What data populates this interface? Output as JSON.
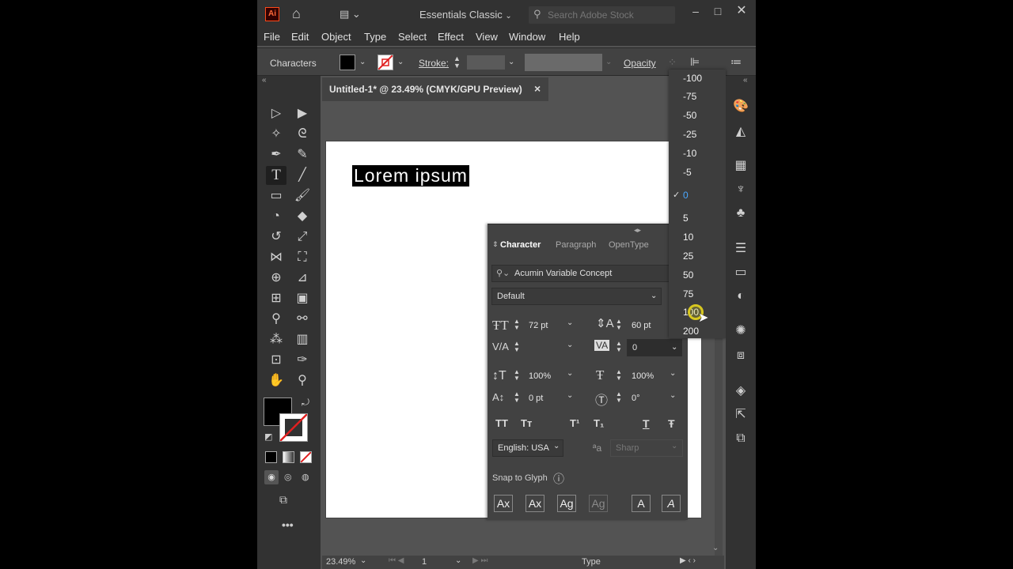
{
  "app": {
    "logo": "Ai",
    "workspace": "Essentials Classic",
    "search_placeholder": "Search Adobe Stock"
  },
  "menu": [
    "File",
    "Edit",
    "Object",
    "Type",
    "Select",
    "Effect",
    "View",
    "Window",
    "Help"
  ],
  "control": {
    "selection_label": "Characters",
    "stroke_label": "Stroke:",
    "opacity_label": "Opacity"
  },
  "document": {
    "tab_title": "Untitled-1* @ 23.49% (CMYK/GPU Preview)",
    "close": "×",
    "artboard_text": "Lorem ipsum"
  },
  "status": {
    "zoom": "23.49%",
    "artboard_num": "1",
    "tool": "Type"
  },
  "character_panel": {
    "tabs": [
      "Character",
      "Paragraph",
      "OpenType"
    ],
    "font_family": "Acumin Variable Concept",
    "font_style": "Default",
    "font_size": "72 pt",
    "leading": "60 pt",
    "kerning": "",
    "tracking": "0",
    "vertical_scale": "100%",
    "horizontal_scale": "100%",
    "baseline_shift": "0 pt",
    "rotation": "0°",
    "language": "English: USA",
    "antialiasing": "Sharp",
    "snap_label": "Snap to Glyph",
    "style_buttons": [
      "TT",
      "Tт",
      "T¹",
      "T₁",
      "T",
      "Ŧ"
    ],
    "glyph_buttons": [
      "Ax",
      "Ax",
      "Ag",
      "Ag",
      "A",
      "A"
    ]
  },
  "tracking_dropdown": {
    "options": [
      "-100",
      "-75",
      "-50",
      "-25",
      "-10",
      "-5",
      "0",
      "5",
      "10",
      "25",
      "50",
      "75",
      "100",
      "200"
    ],
    "checked": "0",
    "hovered": "100"
  },
  "colors": {
    "app_bg": "#535353",
    "dark_bar": "#323232",
    "panel": "#424242",
    "accent_blue": "#4aa7ff",
    "logo_orange": "#ff6a3a",
    "cursor_yellow": "#d8c820"
  }
}
